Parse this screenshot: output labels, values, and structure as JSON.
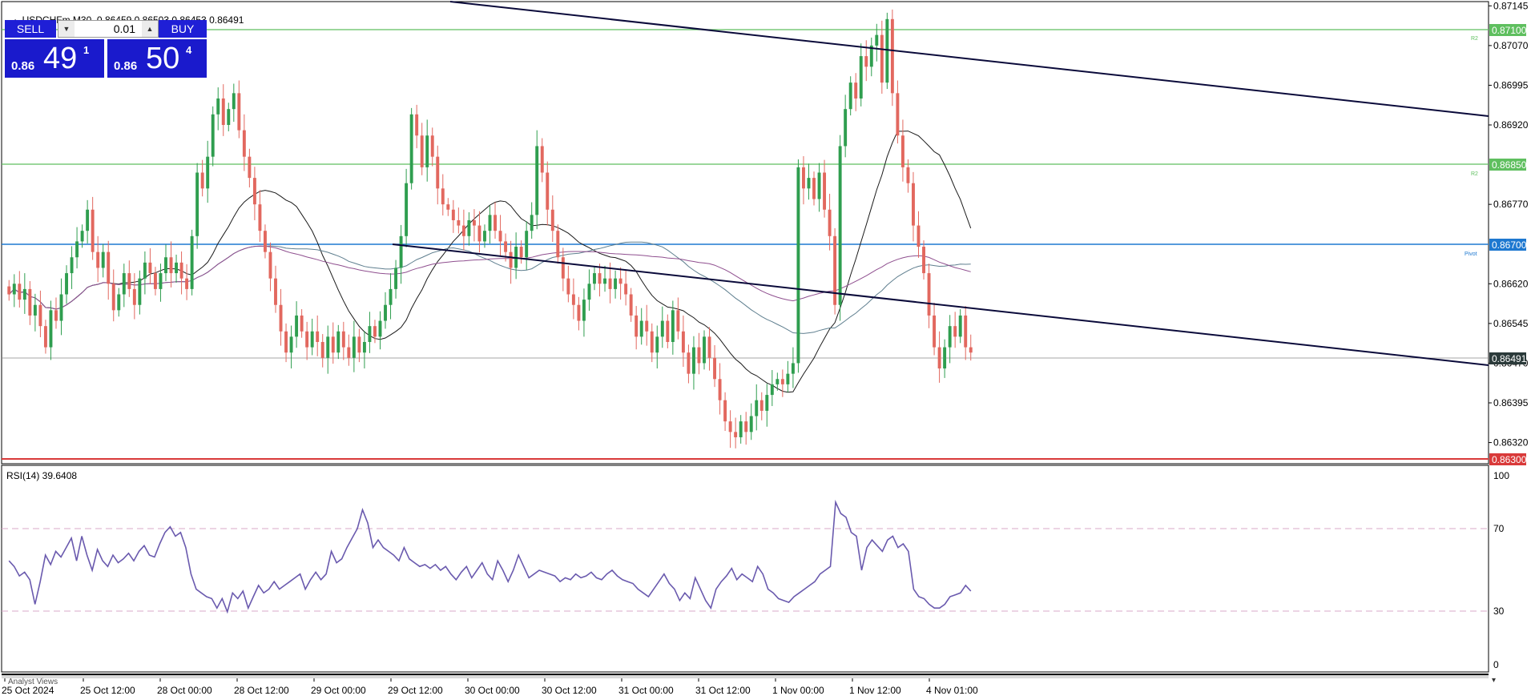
{
  "header": {
    "symbol_line": "USDCHFm,M30  0.86459 0.86503 0.86453 0.86491"
  },
  "trade_panel": {
    "sell_label": "SELL",
    "buy_label": "BUY",
    "volume": "0.01",
    "bid_small": "0.86",
    "bid_big": "49",
    "bid_sup": "1",
    "ask_small": "0.86",
    "ask_big": "50",
    "ask_sup": "4"
  },
  "rsi": {
    "label": "RSI(14) 39.6408",
    "axis": [
      "100",
      "70",
      "30",
      "0"
    ]
  },
  "bottom_panel_label": "Analyst Views",
  "levels": {
    "r2_upper": {
      "price": "0.87100",
      "tag": "R2",
      "color": "#5fbf5f"
    },
    "r2_lower": {
      "price": "0.86850",
      "tag": "R2",
      "color": "#5fbf5f"
    },
    "pivot": {
      "price": "0.86700",
      "tag": "Pivot",
      "color": "#1e78d0"
    },
    "current": {
      "price": "0.86491",
      "color": "#2b3a3a"
    },
    "support": {
      "price": "0.86300",
      "color": "#d93a3a"
    }
  },
  "colors": {
    "bull": "#2f9e4f",
    "bear": "#e2685f",
    "trendline": "#0a0a3a",
    "ma_short": "#1a1a1a",
    "ma_mid": "#5f7f8f",
    "ma_long": "#8f4f8f",
    "rsi_line": "#6a5aae",
    "rsi_level": "#d9a8c8"
  },
  "chart_data": {
    "type": "candlestick",
    "symbol": "USDCHFm",
    "timeframe": "M30",
    "y_ticks": [
      "0.87145",
      "0.87070",
      "0.86995",
      "0.86920",
      "0.86770",
      "0.86620",
      "0.86545",
      "0.86470",
      "0.86395",
      "0.86320"
    ],
    "ylim": [
      0.8628,
      0.8715
    ],
    "x_ticks": [
      "25 Oct 2024",
      "25 Oct 12:00",
      "28 Oct 00:00",
      "28 Oct 12:00",
      "29 Oct 00:00",
      "29 Oct 12:00",
      "30 Oct 00:00",
      "30 Oct 12:00",
      "31 Oct 00:00",
      "31 Oct 12:00",
      "1 Nov 00:00",
      "1 Nov 12:00",
      "4 Nov 01:00"
    ],
    "close_series": [
      0.866,
      0.8662,
      0.8659,
      0.8661,
      0.8656,
      0.8658,
      0.8654,
      0.865,
      0.8657,
      0.8655,
      0.866,
      0.8664,
      0.8667,
      0.867,
      0.8672,
      0.8676,
      0.8668,
      0.8665,
      0.8668,
      0.8662,
      0.8657,
      0.866,
      0.8664,
      0.8661,
      0.8658,
      0.8663,
      0.8666,
      0.8664,
      0.8661,
      0.8664,
      0.8667,
      0.8664,
      0.8666,
      0.8663,
      0.8661,
      0.8671,
      0.8683,
      0.868,
      0.8686,
      0.8694,
      0.8697,
      0.8692,
      0.8695,
      0.8698,
      0.8691,
      0.8686,
      0.8682,
      0.8677,
      0.8672,
      0.8668,
      0.8663,
      0.8658,
      0.8653,
      0.8649,
      0.8652,
      0.8656,
      0.8653,
      0.865,
      0.8653,
      0.8651,
      0.8648,
      0.8652,
      0.8649,
      0.8653,
      0.865,
      0.8648,
      0.8652,
      0.8649,
      0.8651,
      0.8654,
      0.8652,
      0.8655,
      0.8658,
      0.8661,
      0.8665,
      0.8671,
      0.8681,
      0.8694,
      0.869,
      0.8684,
      0.869,
      0.8686,
      0.868,
      0.8677,
      0.8676,
      0.8674,
      0.8673,
      0.8671,
      0.8674,
      0.8673,
      0.867,
      0.8672,
      0.8675,
      0.8672,
      0.867,
      0.8668,
      0.8665,
      0.8669,
      0.8667,
      0.8672,
      0.8675,
      0.8688,
      0.8683,
      0.8676,
      0.8672,
      0.8667,
      0.8663,
      0.866,
      0.8658,
      0.8655,
      0.8659,
      0.8662,
      0.8664,
      0.8662,
      0.8663,
      0.8661,
      0.8663,
      0.8662,
      0.866,
      0.8656,
      0.8652,
      0.8655,
      0.8653,
      0.8649,
      0.8652,
      0.8655,
      0.8651,
      0.8657,
      0.8653,
      0.8649,
      0.8645,
      0.865,
      0.8647,
      0.8652,
      0.8648,
      0.8644,
      0.864,
      0.8636,
      0.8634,
      0.8633,
      0.8636,
      0.8634,
      0.8637,
      0.864,
      0.8638,
      0.8641,
      0.8643,
      0.8644,
      0.8643,
      0.8645,
      0.8647,
      0.8684,
      0.868,
      0.8682,
      0.8678,
      0.8683,
      0.8676,
      0.8671,
      0.8658,
      0.8688,
      0.8695,
      0.87,
      0.8697,
      0.8705,
      0.8703,
      0.8707,
      0.8709,
      0.87,
      0.8712,
      0.8698,
      0.869,
      0.8684,
      0.8681,
      0.8673,
      0.8669,
      0.8664,
      0.8656,
      0.865,
      0.8646,
      0.865,
      0.8654,
      0.8652,
      0.8656,
      0.865,
      0.8649
    ],
    "rsi_values": [
      55,
      52,
      47,
      49,
      45,
      32,
      44,
      58,
      53,
      60,
      57,
      62,
      67,
      55,
      68,
      58,
      50,
      61,
      55,
      52,
      58,
      54,
      56,
      59,
      55,
      60,
      63,
      58,
      57,
      64,
      70,
      73,
      68,
      70,
      62,
      48,
      40,
      38,
      36,
      35,
      30,
      35,
      28,
      38,
      35,
      39,
      30,
      36,
      42,
      38,
      40,
      44,
      40,
      42,
      44,
      46,
      48,
      40,
      45,
      49,
      45,
      48,
      60,
      54,
      56,
      62,
      67,
      72,
      82,
      75,
      62,
      66,
      62,
      60,
      58,
      55,
      62,
      56,
      54,
      52,
      53,
      51,
      53,
      50,
      52,
      48,
      45,
      49,
      52,
      46,
      50,
      54,
      48,
      45,
      55,
      50,
      44,
      50,
      58,
      52,
      46,
      48,
      50,
      49,
      48,
      47,
      44,
      46,
      45,
      48,
      46,
      47,
      49,
      46,
      45,
      48,
      50,
      47,
      45,
      44,
      43,
      40,
      38,
      36,
      40,
      44,
      48,
      43,
      40,
      34,
      38,
      35,
      46,
      40,
      34,
      30,
      40,
      44,
      47,
      51,
      45,
      48,
      46,
      44,
      52,
      48,
      40,
      38,
      35,
      34,
      33,
      36,
      38,
      40,
      42,
      44,
      48,
      50,
      52,
      86,
      80,
      78,
      70,
      68,
      50,
      62,
      66,
      63,
      60,
      66,
      68,
      62,
      64,
      60,
      40,
      36,
      35,
      32,
      30,
      30,
      32,
      36,
      37,
      38,
      42,
      39
    ]
  }
}
